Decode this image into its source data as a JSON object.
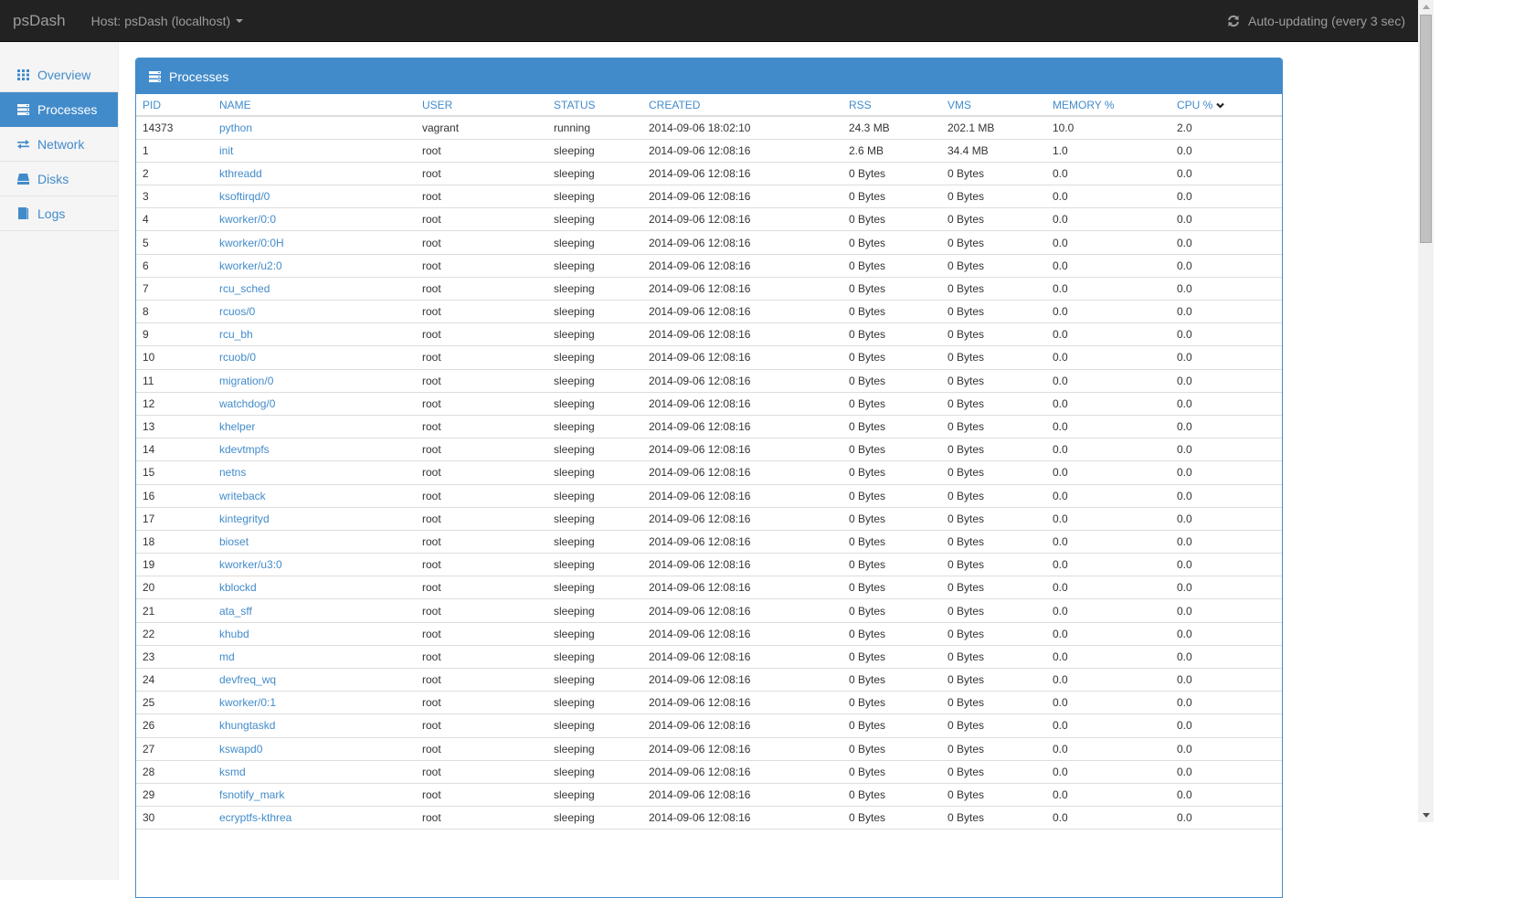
{
  "topbar": {
    "brand": "psDash",
    "host_label": "Host: psDash (localhost)",
    "auto_update_label": "Auto-updating (every 3 sec)"
  },
  "sidebar": {
    "items": [
      {
        "label": "Overview",
        "icon": "grid-icon",
        "active": false
      },
      {
        "label": "Processes",
        "icon": "server-list-icon",
        "active": true
      },
      {
        "label": "Network",
        "icon": "transfer-icon",
        "active": false
      },
      {
        "label": "Disks",
        "icon": "hdd-icon",
        "active": false
      },
      {
        "label": "Logs",
        "icon": "book-icon",
        "active": false
      }
    ]
  },
  "panel": {
    "title": "Processes",
    "sorted_column": "CPU %",
    "sort_direction": "descending",
    "columns": [
      "PID",
      "NAME",
      "USER",
      "STATUS",
      "CREATED",
      "RSS",
      "VMS",
      "MEMORY %",
      "CPU %"
    ],
    "rows": [
      [
        "14373",
        "python",
        "vagrant",
        "running",
        "2014-09-06 18:02:10",
        "24.3 MB",
        "202.1 MB",
        "10.0",
        "2.0"
      ],
      [
        "1",
        "init",
        "root",
        "sleeping",
        "2014-09-06 12:08:16",
        "2.6 MB",
        "34.4 MB",
        "1.0",
        "0.0"
      ],
      [
        "2",
        "kthreadd",
        "root",
        "sleeping",
        "2014-09-06 12:08:16",
        "0 Bytes",
        "0 Bytes",
        "0.0",
        "0.0"
      ],
      [
        "3",
        "ksoftirqd/0",
        "root",
        "sleeping",
        "2014-09-06 12:08:16",
        "0 Bytes",
        "0 Bytes",
        "0.0",
        "0.0"
      ],
      [
        "4",
        "kworker/0:0",
        "root",
        "sleeping",
        "2014-09-06 12:08:16",
        "0 Bytes",
        "0 Bytes",
        "0.0",
        "0.0"
      ],
      [
        "5",
        "kworker/0:0H",
        "root",
        "sleeping",
        "2014-09-06 12:08:16",
        "0 Bytes",
        "0 Bytes",
        "0.0",
        "0.0"
      ],
      [
        "6",
        "kworker/u2:0",
        "root",
        "sleeping",
        "2014-09-06 12:08:16",
        "0 Bytes",
        "0 Bytes",
        "0.0",
        "0.0"
      ],
      [
        "7",
        "rcu_sched",
        "root",
        "sleeping",
        "2014-09-06 12:08:16",
        "0 Bytes",
        "0 Bytes",
        "0.0",
        "0.0"
      ],
      [
        "8",
        "rcuos/0",
        "root",
        "sleeping",
        "2014-09-06 12:08:16",
        "0 Bytes",
        "0 Bytes",
        "0.0",
        "0.0"
      ],
      [
        "9",
        "rcu_bh",
        "root",
        "sleeping",
        "2014-09-06 12:08:16",
        "0 Bytes",
        "0 Bytes",
        "0.0",
        "0.0"
      ],
      [
        "10",
        "rcuob/0",
        "root",
        "sleeping",
        "2014-09-06 12:08:16",
        "0 Bytes",
        "0 Bytes",
        "0.0",
        "0.0"
      ],
      [
        "11",
        "migration/0",
        "root",
        "sleeping",
        "2014-09-06 12:08:16",
        "0 Bytes",
        "0 Bytes",
        "0.0",
        "0.0"
      ],
      [
        "12",
        "watchdog/0",
        "root",
        "sleeping",
        "2014-09-06 12:08:16",
        "0 Bytes",
        "0 Bytes",
        "0.0",
        "0.0"
      ],
      [
        "13",
        "khelper",
        "root",
        "sleeping",
        "2014-09-06 12:08:16",
        "0 Bytes",
        "0 Bytes",
        "0.0",
        "0.0"
      ],
      [
        "14",
        "kdevtmpfs",
        "root",
        "sleeping",
        "2014-09-06 12:08:16",
        "0 Bytes",
        "0 Bytes",
        "0.0",
        "0.0"
      ],
      [
        "15",
        "netns",
        "root",
        "sleeping",
        "2014-09-06 12:08:16",
        "0 Bytes",
        "0 Bytes",
        "0.0",
        "0.0"
      ],
      [
        "16",
        "writeback",
        "root",
        "sleeping",
        "2014-09-06 12:08:16",
        "0 Bytes",
        "0 Bytes",
        "0.0",
        "0.0"
      ],
      [
        "17",
        "kintegrityd",
        "root",
        "sleeping",
        "2014-09-06 12:08:16",
        "0 Bytes",
        "0 Bytes",
        "0.0",
        "0.0"
      ],
      [
        "18",
        "bioset",
        "root",
        "sleeping",
        "2014-09-06 12:08:16",
        "0 Bytes",
        "0 Bytes",
        "0.0",
        "0.0"
      ],
      [
        "19",
        "kworker/u3:0",
        "root",
        "sleeping",
        "2014-09-06 12:08:16",
        "0 Bytes",
        "0 Bytes",
        "0.0",
        "0.0"
      ],
      [
        "20",
        "kblockd",
        "root",
        "sleeping",
        "2014-09-06 12:08:16",
        "0 Bytes",
        "0 Bytes",
        "0.0",
        "0.0"
      ],
      [
        "21",
        "ata_sff",
        "root",
        "sleeping",
        "2014-09-06 12:08:16",
        "0 Bytes",
        "0 Bytes",
        "0.0",
        "0.0"
      ],
      [
        "22",
        "khubd",
        "root",
        "sleeping",
        "2014-09-06 12:08:16",
        "0 Bytes",
        "0 Bytes",
        "0.0",
        "0.0"
      ],
      [
        "23",
        "md",
        "root",
        "sleeping",
        "2014-09-06 12:08:16",
        "0 Bytes",
        "0 Bytes",
        "0.0",
        "0.0"
      ],
      [
        "24",
        "devfreq_wq",
        "root",
        "sleeping",
        "2014-09-06 12:08:16",
        "0 Bytes",
        "0 Bytes",
        "0.0",
        "0.0"
      ],
      [
        "25",
        "kworker/0:1",
        "root",
        "sleeping",
        "2014-09-06 12:08:16",
        "0 Bytes",
        "0 Bytes",
        "0.0",
        "0.0"
      ],
      [
        "26",
        "khungtaskd",
        "root",
        "sleeping",
        "2014-09-06 12:08:16",
        "0 Bytes",
        "0 Bytes",
        "0.0",
        "0.0"
      ],
      [
        "27",
        "kswapd0",
        "root",
        "sleeping",
        "2014-09-06 12:08:16",
        "0 Bytes",
        "0 Bytes",
        "0.0",
        "0.0"
      ],
      [
        "28",
        "ksmd",
        "root",
        "sleeping",
        "2014-09-06 12:08:16",
        "0 Bytes",
        "0 Bytes",
        "0.0",
        "0.0"
      ],
      [
        "29",
        "fsnotify_mark",
        "root",
        "sleeping",
        "2014-09-06 12:08:16",
        "0 Bytes",
        "0 Bytes",
        "0.0",
        "0.0"
      ],
      [
        "30",
        "ecryptfs-kthrea",
        "root",
        "sleeping",
        "2014-09-06 12:08:16",
        "0 Bytes",
        "0 Bytes",
        "0.0",
        "0.0"
      ]
    ]
  },
  "colors": {
    "navbar_bg": "#222222",
    "navbar_text": "#9d9d9d",
    "accent": "#428bca",
    "sidebar_bg": "#f5f5f5",
    "row_border": "#dddddd"
  }
}
